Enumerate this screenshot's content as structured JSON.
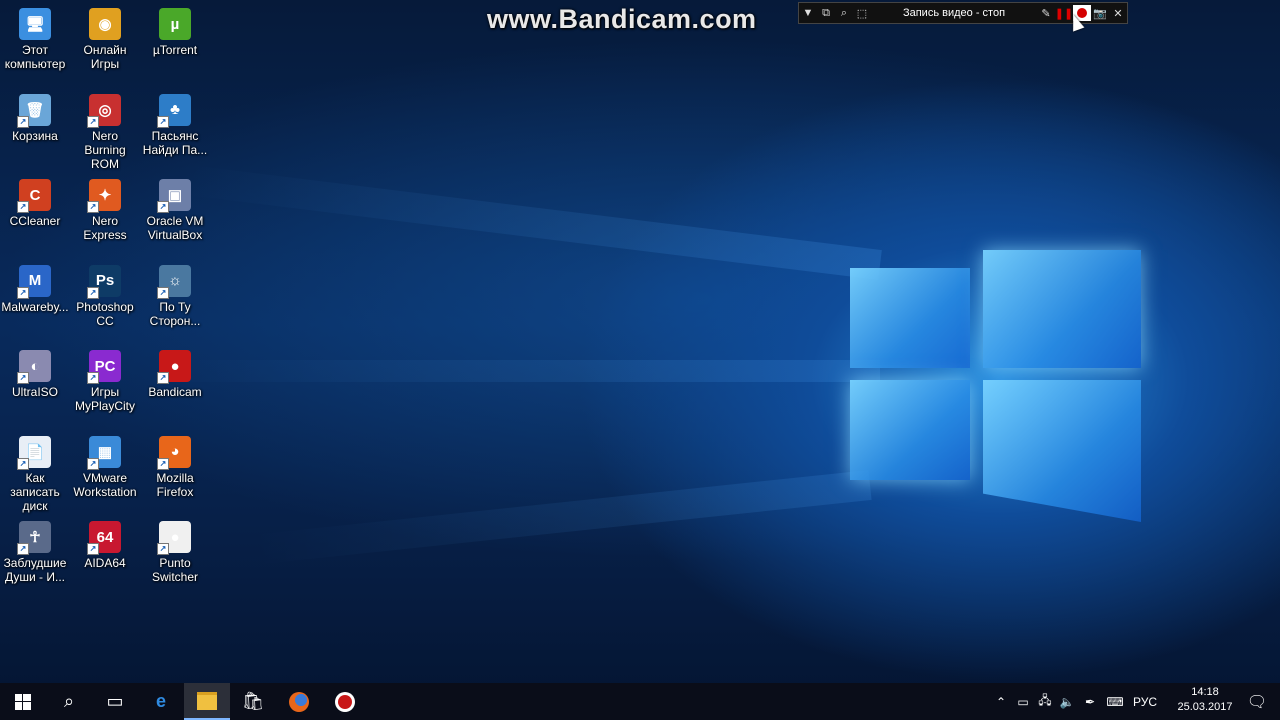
{
  "watermark": "www.Bandicam.com",
  "bandicam_toolbar": {
    "title": "Запись видео - стоп",
    "icons": [
      "dropdown-icon",
      "window-icon",
      "search-icon",
      "region-icon",
      "pencil-icon",
      "pause-icon",
      "record-icon",
      "camera-icon",
      "close-icon"
    ]
  },
  "desktop": {
    "icons": [
      {
        "id": "this-pc",
        "label": "Этот компьютер",
        "color": "#3b8fe0",
        "glyph": "🖥"
      },
      {
        "id": "online-games",
        "label": "Онлайн Игры",
        "color": "#e0a020",
        "glyph": "◉"
      },
      {
        "id": "utorrent",
        "label": "µTorrent",
        "color": "#4aa829",
        "glyph": "µ"
      },
      {
        "id": "recycle-bin",
        "label": "Корзина",
        "color": "#6aa6d8",
        "glyph": "🗑"
      },
      {
        "id": "nero-burning-rom",
        "label": "Nero Burning ROM",
        "color": "#c83030",
        "glyph": "◎"
      },
      {
        "id": "solitaire",
        "label": "Пасьянс Найди Па...",
        "color": "#2d7dc8",
        "glyph": "♣"
      },
      {
        "id": "ccleaner",
        "label": "CCleaner",
        "color": "#d04020",
        "glyph": "C"
      },
      {
        "id": "nero-express",
        "label": "Nero Express",
        "color": "#e05a20",
        "glyph": "✦"
      },
      {
        "id": "virtualbox",
        "label": "Oracle VM VirtualBox",
        "color": "#6d7fa8",
        "glyph": "▣"
      },
      {
        "id": "malwarebytes",
        "label": "Malwareby...",
        "color": "#2a66c8",
        "glyph": "M"
      },
      {
        "id": "photoshop",
        "label": "Photoshop CC",
        "color": "#0e3b66",
        "glyph": "Ps"
      },
      {
        "id": "po-tu-storonu",
        "label": "По Ту Сторон...",
        "color": "#4a78a0",
        "glyph": "☼"
      },
      {
        "id": "ultraiso",
        "label": "UltraISO",
        "color": "#8a8ab0",
        "glyph": "◐"
      },
      {
        "id": "myplaycity",
        "label": "Игры MyPlayCity",
        "color": "#8a2ad0",
        "glyph": "PC"
      },
      {
        "id": "bandicam",
        "label": "Bandicam",
        "color": "#c81818",
        "glyph": "●"
      },
      {
        "id": "how-to-record",
        "label": "Как записать диск",
        "color": "#e8eef6",
        "glyph": "📄"
      },
      {
        "id": "vmware",
        "label": "VMware Workstation",
        "color": "#3a8ad8",
        "glyph": "▦"
      },
      {
        "id": "firefox",
        "label": "Mozilla Firefox",
        "color": "#e8661a",
        "glyph": "◕"
      },
      {
        "id": "zabludshie-dushi",
        "label": "Заблудшие Души - И...",
        "color": "#5a6a8a",
        "glyph": "☥"
      },
      {
        "id": "aida64",
        "label": "AIDA64",
        "color": "#c81830",
        "glyph": "64"
      },
      {
        "id": "punto-switcher",
        "label": "Punto Switcher",
        "color": "#f0f0f0",
        "glyph": "●"
      }
    ]
  },
  "taskbar": {
    "items": [
      "start-icon",
      "search-icon",
      "task-view-icon",
      "edge-icon",
      "file-explorer-icon",
      "store-icon",
      "firefox-icon",
      "bandicam-icon"
    ],
    "language": "РУС",
    "time": "14:18",
    "date": "25.03.2017"
  }
}
